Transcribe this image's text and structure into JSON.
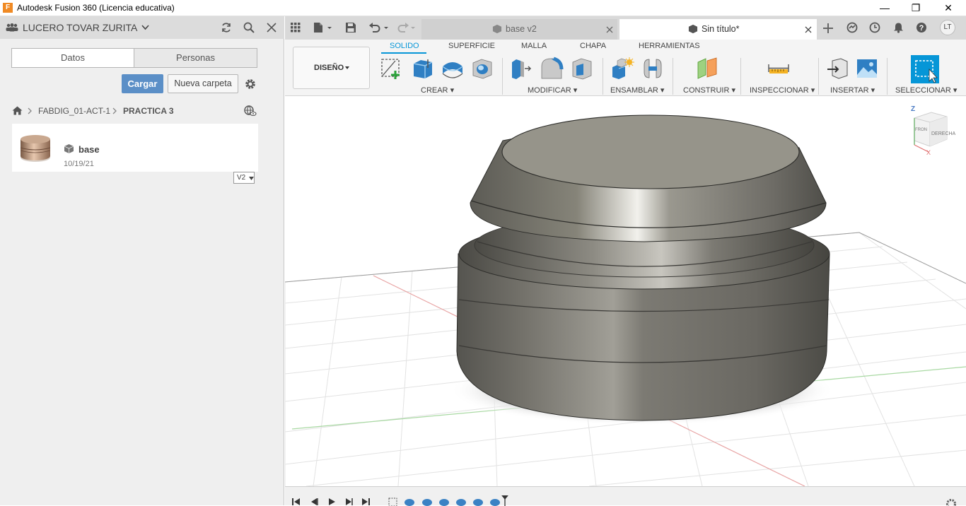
{
  "window": {
    "title": "Autodesk Fusion 360 (Licencia educativa)",
    "app_icon_letter": "F",
    "minimize": "—",
    "maximize": "❐",
    "close": "✕"
  },
  "data_panel": {
    "user_name": "LUCERO TOVAR ZURITA",
    "tabs": [
      "Datos",
      "Personas"
    ],
    "upload_label": "Cargar",
    "new_folder_label": "Nueva carpeta",
    "breadcrumb": [
      "FABDIG_01-ACT-1",
      "PRACTICA 3"
    ],
    "files": [
      {
        "name": "base",
        "date": "10/19/21",
        "version": "V2"
      }
    ]
  },
  "doc_tabs": [
    {
      "label": "base v2",
      "active": false
    },
    {
      "label": "Sin título*",
      "active": true
    }
  ],
  "account_initials": "LT",
  "ribbon": {
    "workspace": "DISEÑO",
    "tabs": [
      "SOLIDO",
      "SUPERFICIE",
      "MALLA",
      "CHAPA",
      "HERRAMIENTAS"
    ],
    "active_tab": "SOLIDO",
    "groups": [
      "CREAR",
      "MODIFICAR",
      "ENSAMBLAR",
      "CONSTRUIR",
      "INSPECCIONAR",
      "INSERTAR",
      "SELECCIONAR"
    ]
  },
  "viewcube": {
    "face_front": "DERECHA",
    "face_side": "FRON",
    "axis_z": "Z",
    "axis_x": "X"
  },
  "colors": {
    "accent": "#0696d7",
    "upload_button": "#5b8fc7",
    "panel_bg": "#efefef",
    "model_metal": "#7d7b73",
    "grid_line": "#e2e2e2",
    "axis_red": "#e8a3a3",
    "axis_green": "#a9d9a3"
  }
}
